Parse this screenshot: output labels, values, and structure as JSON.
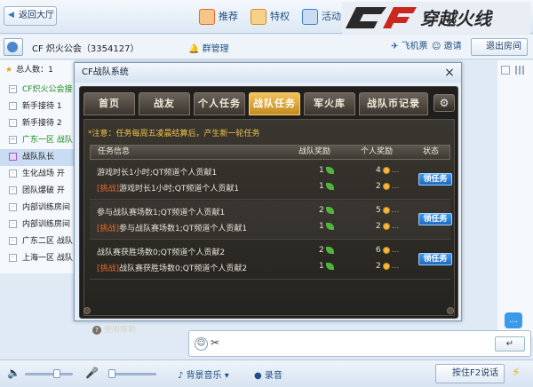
{
  "topbar": {
    "back_label": "返回大厅",
    "nav": [
      {
        "label": "推荐",
        "icon": "house-icon",
        "color": "#e06b2a"
      },
      {
        "label": "特权",
        "icon": "gift-icon",
        "color": "#d98c2a"
      },
      {
        "label": "活动",
        "icon": "calendar-icon",
        "color": "#3f7fc8"
      }
    ],
    "logo_text": "穿越火线"
  },
  "bar2": {
    "guild_name": "CF 炽火公会（3354127）",
    "management": "群管理",
    "airplane_ticket": "飞机票",
    "invite": "邀请",
    "exit_room": "退出房间"
  },
  "sidebar": {
    "total_label": "总人数：1",
    "items": [
      {
        "label": "CF炽火公会接",
        "style": "green"
      },
      {
        "label": "新手接待 1",
        "style": "normal"
      },
      {
        "label": "新手接待 2",
        "style": "normal"
      },
      {
        "label": "广东一区 战队",
        "style": "green"
      },
      {
        "label": "战队队长",
        "style": "selected"
      },
      {
        "label": "生化战场 开",
        "style": "normal"
      },
      {
        "label": "团队爆破 开",
        "style": "normal"
      },
      {
        "label": "内部训练房间",
        "style": "normal"
      },
      {
        "label": "内部训练房间",
        "style": "normal"
      },
      {
        "label": "广东二区 战队",
        "style": "normal"
      },
      {
        "label": "上海一区 战队",
        "style": "normal"
      }
    ]
  },
  "popup": {
    "title": "CF战队系统",
    "close": "×",
    "tabs": [
      "首页",
      "战友",
      "个人任务",
      "战队任务",
      "军火库",
      "战队币记录"
    ],
    "active_tab": 3,
    "gear": "⚙",
    "notice": "*注意：任务每周五凌晨结算后，产生新一轮任务",
    "headers": {
      "info": "任务信息",
      "team_reward": "战队奖励",
      "personal_reward": "个人奖励",
      "status": "状态"
    },
    "tasks": [
      {
        "line1": "游戏时长1小时;QT频道个人贡献1",
        "tag": "[挑战]",
        "line2": "游戏时长1小时;QT频道个人贡献1",
        "team1": "1",
        "team2": "1",
        "pers1": "4",
        "pers2": "2",
        "action": "领任务"
      },
      {
        "line1": "参与战队赛场数1;QT频道个人贡献1",
        "tag": "[挑战]",
        "line2": "参与战队赛场数1;QT频道个人贡献1",
        "team1": "2",
        "team2": "1",
        "pers1": "5",
        "pers2": "2",
        "action": "领任务"
      },
      {
        "line1": "战队赛获胜场数0;QT频道个人贡献2",
        "tag": "[挑战]",
        "line2": "战队赛获胜场数0;QT频道个人贡献2",
        "team1": "2",
        "team2": "1",
        "pers1": "6",
        "pers2": "2",
        "action": "领任务"
      }
    ],
    "dots": "...",
    "help": "使用帮助"
  },
  "input_area": {
    "send_label": "↵"
  },
  "bottombar": {
    "music": "背景音乐",
    "record": "录音",
    "ptt": "按住F2说话"
  }
}
